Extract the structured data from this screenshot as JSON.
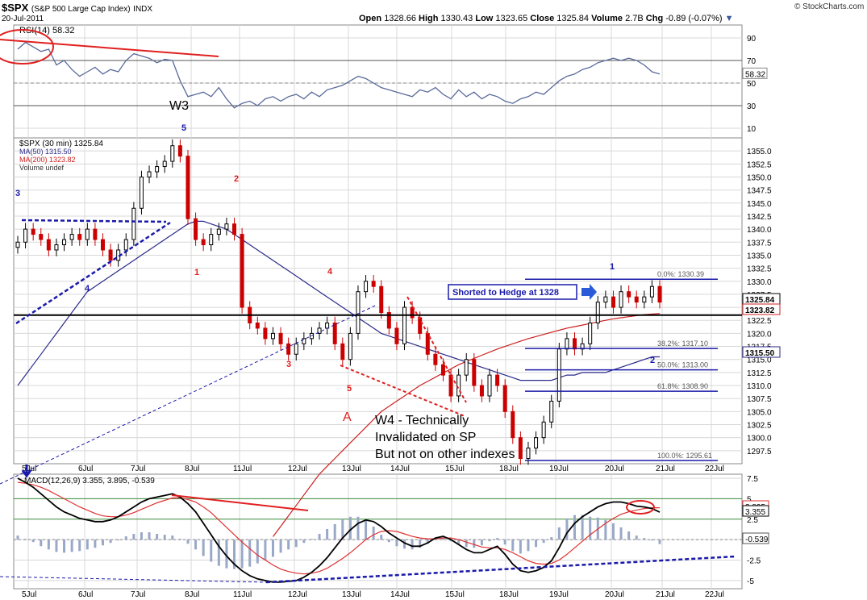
{
  "header": {
    "symbol": "$SPX",
    "name": "(S&P 500 Large Cap Index)",
    "exchange": "INDX",
    "date": "20-Jul-2011",
    "watermark": "© StockCharts.com",
    "open_label": "Open",
    "open": "1328.66",
    "high_label": "High",
    "high": "1330.43",
    "low_label": "Low",
    "low": "1323.65",
    "close_label": "Close",
    "close": "1325.84",
    "volume_label": "Volume",
    "volume": "2.7B",
    "chg_label": "Chg",
    "chg": "-0.89 (-0.07%)"
  },
  "colors": {
    "price_up": "#000000",
    "price_down": "#cc0000",
    "ma50": "#2a2a8a",
    "ma200": "#cc2020",
    "rsi": "#5a6a9a",
    "annotation_red": "#e02020",
    "annotation_blue": "#1a1aaa",
    "grid": "#d8d8d8"
  },
  "chart_data": [
    {
      "type": "line",
      "panel": "RSI",
      "legend": "RSI(14) 58.32",
      "last_value_label": "58.32",
      "ylim": [
        0,
        100
      ],
      "yticks": [
        10,
        30,
        50,
        70,
        90
      ],
      "x": [
        "5Jul 9:30",
        "5Jul 10",
        "5Jul 11",
        "5Jul 12",
        "5Jul 13",
        "5Jul 14",
        "5Jul 15",
        "6Jul 9:30",
        "6Jul 10",
        "6Jul 11",
        "6Jul 12",
        "6Jul 13",
        "6Jul 14",
        "6Jul 15",
        "7Jul 9:30",
        "7Jul 10",
        "7Jul 11",
        "7Jul 12",
        "7Jul 13",
        "7Jul 14",
        "7Jul 15",
        "8Jul 9:30",
        "8Jul 10",
        "8Jul 11",
        "8Jul 12",
        "8Jul 13",
        "8Jul 14",
        "8Jul 15",
        "11Jul 9:30",
        "11Jul 10",
        "11Jul 11",
        "11Jul 12",
        "11Jul 13",
        "11Jul 14",
        "11Jul 15",
        "12Jul 9:30",
        "12Jul 10",
        "12Jul 11",
        "12Jul 12",
        "12Jul 13",
        "12Jul 14",
        "12Jul 15",
        "13Jul 9:30",
        "13Jul 10",
        "13Jul 11",
        "13Jul 12",
        "13Jul 13",
        "13Jul 14",
        "13Jul 15",
        "14Jul 9:30",
        "14Jul 10",
        "14Jul 11",
        "14Jul 12",
        "14Jul 13",
        "14Jul 14",
        "14Jul 15",
        "15Jul 9:30",
        "15Jul 10",
        "15Jul 11",
        "15Jul 12",
        "15Jul 13",
        "15Jul 14",
        "15Jul 15",
        "18Jul 9:30",
        "18Jul 10",
        "18Jul 11",
        "18Jul 12",
        "18Jul 13",
        "18Jul 14",
        "18Jul 15",
        "19Jul 9:30",
        "19Jul 10",
        "19Jul 11",
        "19Jul 12",
        "19Jul 13",
        "19Jul 14",
        "19Jul 15",
        "20Jul 9:30",
        "20Jul 10",
        "20Jul 11",
        "20Jul 12",
        "20Jul 13",
        "20Jul 14",
        "20Jul 15"
      ],
      "values": [
        80,
        86,
        82,
        78,
        80,
        66,
        70,
        62,
        56,
        60,
        64,
        58,
        62,
        60,
        70,
        76,
        74,
        72,
        68,
        71,
        70,
        52,
        38,
        40,
        42,
        38,
        46,
        36,
        28,
        32,
        34,
        30,
        36,
        38,
        34,
        38,
        40,
        36,
        42,
        38,
        44,
        46,
        48,
        52,
        56,
        54,
        50,
        46,
        44,
        42,
        40,
        38,
        44,
        42,
        46,
        40,
        36,
        44,
        38,
        42,
        36,
        40,
        38,
        34,
        32,
        36,
        38,
        42,
        40,
        46,
        52,
        56,
        58,
        62,
        64,
        68,
        70,
        72,
        70,
        72,
        70,
        66,
        60,
        58
      ]
    },
    {
      "type": "line",
      "panel": "Price",
      "legend": [
        "$SPX (30 min) 1325.84",
        "MA(50) 1315.50",
        "MA(200) 1323.82",
        "Volume undef"
      ],
      "last_value_labels": [
        "1325.84",
        "1323.82",
        "1315.50"
      ],
      "ylim": [
        1295,
        1357.5
      ],
      "yticks": [
        1297.5,
        1300,
        1302.5,
        1305,
        1307.5,
        1310,
        1312.5,
        1315,
        1317.5,
        1320,
        1322.5,
        1325,
        1327.5,
        1330,
        1332.5,
        1335,
        1337.5,
        1340,
        1342.5,
        1345,
        1347.5,
        1350,
        1352.5,
        1355
      ],
      "x_labels": [
        "5Jul",
        "6Jul",
        "7Jul",
        "8Jul",
        "11Jul",
        "12Jul",
        "13Jul",
        "14Jul",
        "15Jul",
        "18Jul",
        "19Jul",
        "20Jul",
        "21Jul",
        "22Jul"
      ],
      "series": [
        {
          "name": "$SPX (30 min)",
          "values": [
            1337.5,
            1340,
            1339,
            1338,
            1336,
            1337,
            1338,
            1339,
            1338,
            1340,
            1338,
            1336,
            1334,
            1336,
            1338,
            1344,
            1350,
            1351,
            1352,
            1353,
            1356,
            1354,
            1342,
            1338,
            1337,
            1339,
            1340,
            1341,
            1339,
            1325,
            1322,
            1321,
            1319,
            1320,
            1318,
            1316,
            1318,
            1319,
            1320,
            1321,
            1322,
            1318,
            1315,
            1320,
            1328,
            1330,
            1329,
            1324,
            1321,
            1318,
            1325,
            1323,
            1320,
            1316,
            1314,
            1312,
            1308,
            1312,
            1315,
            1310,
            1308,
            1312,
            1310,
            1305,
            1300,
            1296,
            1298,
            1300,
            1303,
            1307,
            1317,
            1319,
            1317,
            1318,
            1322,
            1326,
            1327,
            1325,
            1328,
            1327,
            1326,
            1327,
            1329,
            1326
          ]
        },
        {
          "name": "MA(50)",
          "values": [
            1310,
            1312,
            1314,
            1316,
            1318,
            1320,
            1322,
            1324,
            1326,
            1328,
            1329,
            1330,
            1331,
            1332,
            1333,
            1334,
            1335,
            1336,
            1337,
            1338,
            1339,
            1340,
            1341,
            1341.5,
            1341.5,
            1341,
            1340.5,
            1340,
            1339,
            1338,
            1337,
            1336,
            1335,
            1334,
            1333,
            1332,
            1331,
            1330,
            1329,
            1328,
            1327,
            1326,
            1325,
            1324,
            1323,
            1322,
            1321,
            1320,
            1319.5,
            1319,
            1318.5,
            1318,
            1317.5,
            1317,
            1316.5,
            1316,
            1315.5,
            1315,
            1314.5,
            1314,
            1313.5,
            1313,
            1312.5,
            1312,
            1311.5,
            1311,
            1311,
            1311,
            1311,
            1311,
            1311.5,
            1312,
            1312,
            1312.5,
            1312.5,
            1312.5,
            1312.5,
            1313,
            1313.5,
            1314,
            1314.5,
            1315,
            1315.5,
            1315.5
          ]
        },
        {
          "name": "MA(200)",
          "values": [
            null,
            null,
            null,
            null,
            null,
            null,
            null,
            null,
            null,
            null,
            null,
            null,
            null,
            null,
            null,
            null,
            null,
            null,
            null,
            null,
            null,
            null,
            null,
            null,
            null,
            null,
            null,
            null,
            null,
            null,
            null,
            null,
            null,
            1281,
            1283,
            1285,
            1287,
            1289,
            1291,
            1293,
            1294.5,
            1296,
            1297.5,
            1299,
            1300.5,
            1302,
            1303.5,
            1305,
            1306,
            1307,
            1308,
            1309,
            1310,
            1310.8,
            1311.6,
            1312.4,
            1313.2,
            1314,
            1314.6,
            1315.2,
            1315.8,
            1316.4,
            1317,
            1317.5,
            1318,
            1318.5,
            1319,
            1319.4,
            1319.8,
            1320.2,
            1320.6,
            1321,
            1321.3,
            1321.6,
            1321.9,
            1322.2,
            1322.5,
            1322.8,
            1323,
            1323.2,
            1323.4,
            1323.6,
            1323.7,
            1323.82
          ]
        }
      ],
      "horizontal_line": 1323.5,
      "fibonacci": [
        {
          "label": "0.0%: 1330.39",
          "value": 1330.39
        },
        {
          "label": "38.2%: 1317.10",
          "value": 1317.1
        },
        {
          "label": "50.0%: 1313.00",
          "value": 1313.0
        },
        {
          "label": "61.8%: 1308.90",
          "value": 1308.9
        },
        {
          "label": "100.0%: 1295.61",
          "value": 1295.61
        }
      ]
    },
    {
      "type": "line",
      "panel": "MACD",
      "legend": "MACD(12,26,9) 3.355, 3.895, -0.539",
      "last_value_labels": [
        "3.895",
        "3.355",
        "-0.539"
      ],
      "ylim": [
        -6,
        8
      ],
      "yticks": [
        -5,
        -2.5,
        0,
        2.5,
        5,
        7.5
      ],
      "series": [
        {
          "name": "MACD",
          "values": [
            7.5,
            7,
            6.4,
            5.6,
            4.8,
            4.0,
            3.4,
            3.0,
            2.6,
            2.4,
            2.2,
            2.2,
            2.4,
            2.8,
            3.4,
            4.0,
            4.6,
            5.0,
            5.2,
            5.4,
            5.6,
            5.2,
            4.4,
            3.4,
            2.0,
            0.6,
            -0.8,
            -2.0,
            -3.0,
            -3.8,
            -4.4,
            -4.8,
            -5.0,
            -5.2,
            -5.2,
            -5.1,
            -5.0,
            -4.6,
            -4.0,
            -3.2,
            -2.2,
            -1.0,
            0.2,
            1.2,
            2.0,
            2.4,
            2.2,
            1.6,
            0.8,
            0.2,
            -0.4,
            -0.8,
            -0.8,
            -0.4,
            0.2,
            0.4,
            0.0,
            -0.6,
            -1.2,
            -1.6,
            -1.6,
            -1.2,
            -0.8,
            -1.8,
            -3.0,
            -3.8,
            -4.0,
            -3.8,
            -3.4,
            -2.6,
            -1.0,
            0.8,
            2.0,
            2.8,
            3.4,
            4.0,
            4.4,
            4.6,
            4.6,
            4.4,
            4.1,
            4.0,
            3.8,
            3.355
          ]
        },
        {
          "name": "Signal",
          "values": [
            7.0,
            6.9,
            6.7,
            6.4,
            6.0,
            5.5,
            5.0,
            4.5,
            4.0,
            3.6,
            3.2,
            2.9,
            2.8,
            2.8,
            3.0,
            3.3,
            3.7,
            4.1,
            4.5,
            4.8,
            5.1,
            5.1,
            4.9,
            4.6,
            4.0,
            3.3,
            2.4,
            1.5,
            0.6,
            -0.3,
            -1.1,
            -1.9,
            -2.5,
            -3.1,
            -3.6,
            -3.9,
            -4.1,
            -4.2,
            -4.1,
            -3.9,
            -3.5,
            -2.9,
            -2.3,
            -1.6,
            -0.8,
            0.0,
            0.6,
            1.0,
            1.1,
            1.0,
            0.7,
            0.4,
            0.2,
            0.1,
            0.1,
            0.2,
            0.2,
            0.0,
            -0.3,
            -0.6,
            -0.9,
            -1.0,
            -1.0,
            -1.2,
            -1.6,
            -2.1,
            -2.6,
            -2.9,
            -3.0,
            -2.9,
            -2.5,
            -1.8,
            -1.0,
            -0.2,
            0.6,
            1.3,
            2.0,
            2.6,
            3.1,
            3.4,
            3.6,
            3.8,
            3.9,
            3.895
          ]
        },
        {
          "name": "Histogram",
          "values": [
            0.5,
            0.1,
            -0.3,
            -0.8,
            -1.2,
            -1.5,
            -1.6,
            -1.5,
            -1.4,
            -1.2,
            -1.0,
            -0.7,
            -0.4,
            0.0,
            0.4,
            0.7,
            0.9,
            0.9,
            0.7,
            0.6,
            0.5,
            0.1,
            -0.5,
            -1.2,
            -2.0,
            -2.7,
            -3.2,
            -3.5,
            -3.6,
            -3.5,
            -3.3,
            -2.9,
            -2.5,
            -2.1,
            -1.6,
            -1.2,
            -0.9,
            -0.4,
            0.1,
            0.7,
            1.3,
            1.9,
            2.5,
            2.8,
            2.8,
            2.4,
            1.6,
            0.6,
            -0.3,
            -0.8,
            -1.1,
            -1.2,
            -1.0,
            -0.5,
            0.1,
            0.2,
            -0.2,
            -0.6,
            -0.9,
            -1.0,
            -0.7,
            -0.2,
            0.2,
            -0.6,
            -1.4,
            -1.7,
            -1.4,
            -0.9,
            -0.4,
            0.3,
            1.5,
            2.6,
            3.0,
            3.0,
            2.8,
            2.7,
            2.4,
            2.0,
            1.5,
            1.0,
            0.5,
            0.2,
            -0.1,
            -0.539
          ]
        }
      ]
    }
  ],
  "annotations": {
    "w3": "W3",
    "a_label": "A",
    "shorted_box": "Shorted to Hedge at 1328",
    "w4_line1": "W4 - Technically",
    "w4_line2": "Invalidated on SP",
    "w4_line3": "But not on other indexes",
    "wave_3_blue": "3",
    "wave_4_blue": "4",
    "wave_5_blue": "5",
    "wave_2_red": "2",
    "wave_1_red": "1",
    "wave_4_red": "4",
    "wave_3_red": "3",
    "wave_5_red": "5",
    "wave_1_blue": "1",
    "wave_2_blue": "2"
  }
}
